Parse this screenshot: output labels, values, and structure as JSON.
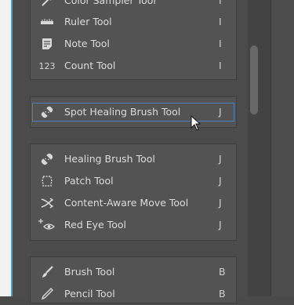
{
  "groups": [
    {
      "items": [
        {
          "label": "Color Sampler Tool",
          "key": "I",
          "icon": "color-sampler-icon"
        },
        {
          "label": "Ruler Tool",
          "key": "I",
          "icon": "ruler-icon"
        },
        {
          "label": "Note Tool",
          "key": "I",
          "icon": "note-icon"
        },
        {
          "label": "Count Tool",
          "key": "I",
          "icon": "count-icon"
        }
      ]
    },
    {
      "items": [
        {
          "label": "Spot Healing Brush Tool",
          "key": "J",
          "icon": "bandage-icon",
          "selected": true
        }
      ]
    },
    {
      "items": [
        {
          "label": "Healing Brush Tool",
          "key": "J",
          "icon": "bandage-icon"
        },
        {
          "label": "Patch Tool",
          "key": "J",
          "icon": "patch-icon"
        },
        {
          "label": "Content-Aware Move Tool",
          "key": "J",
          "icon": "content-aware-move-icon"
        },
        {
          "label": "Red Eye Tool",
          "key": "J",
          "icon": "red-eye-icon"
        }
      ]
    },
    {
      "items": [
        {
          "label": "Brush Tool",
          "key": "B",
          "icon": "brush-icon"
        },
        {
          "label": "Pencil Tool",
          "key": "B",
          "icon": "pencil-icon"
        }
      ]
    }
  ],
  "count_icon_text": "123"
}
